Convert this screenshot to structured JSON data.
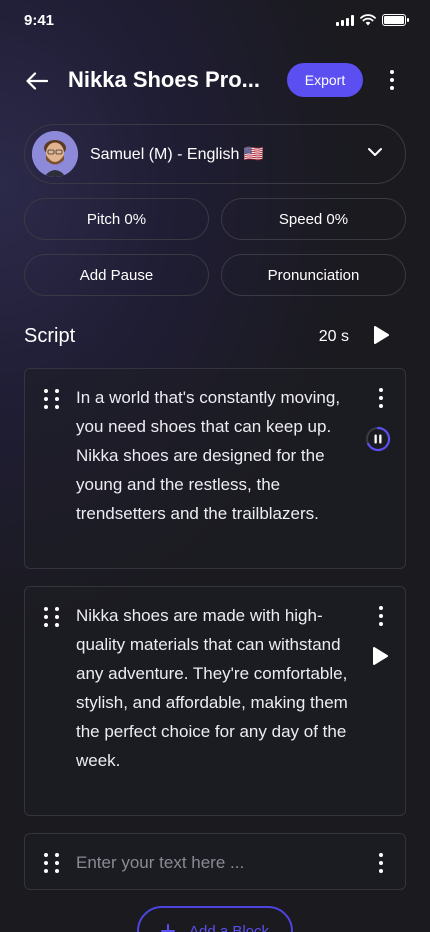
{
  "status_bar": {
    "time": "9:41"
  },
  "header": {
    "title": "Nikka Shoes Pro...",
    "export_label": "Export"
  },
  "voice": {
    "label": "Samuel (M) - English 🇺🇸"
  },
  "controls": {
    "pitch_label": "Pitch 0%",
    "speed_label": "Speed 0%",
    "add_pause_label": "Add Pause",
    "pronunciation_label": "Pronunciation"
  },
  "script": {
    "title": "Script",
    "duration": "20 s",
    "blocks": [
      {
        "text": "In a world that's constantly moving, you need shoes that can keep up. Nikka shoes are designed for the young and the restless, the trendsetters and the trailblazers.",
        "state": "playing"
      },
      {
        "text": "Nikka shoes are made with high-quality materials that can withstand any adventure. They're comfortable, stylish, and affordable, making them the perfect choice for any day of the week.",
        "state": "paused"
      }
    ],
    "new_block_placeholder": "Enter your text here ...",
    "add_block_label": "Add a Block"
  },
  "colors": {
    "accent": "#5b4ff2",
    "background": "#1c1b22",
    "border": "#3a3a44"
  },
  "icons": [
    "back-arrow-icon",
    "kebab-icon",
    "chevron-down-icon",
    "play-icon",
    "pause-icon",
    "drag-handle-icon",
    "plus-icon",
    "signal-icon",
    "wifi-icon",
    "battery-icon"
  ]
}
